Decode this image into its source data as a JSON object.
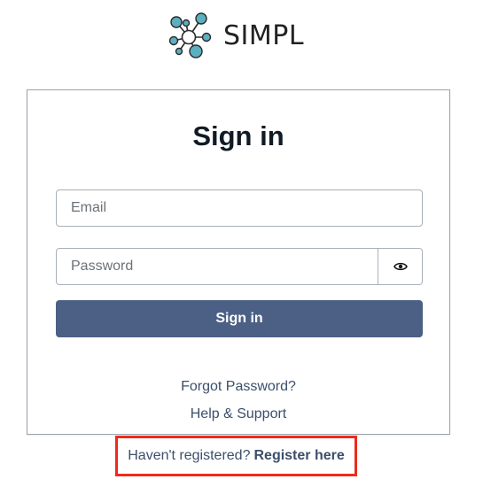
{
  "brand": {
    "name": "SIMPL",
    "logo_icon": "molecule-network-icon",
    "logo_colors": {
      "node": "#5ab0c0",
      "stroke": "#2a2a2a"
    }
  },
  "signin": {
    "title": "Sign in",
    "email_placeholder": "Email",
    "password_placeholder": "Password",
    "show_password_icon": "eye-icon",
    "submit_label": "Sign in",
    "forgot_password": "Forgot Password?",
    "help_support": "Help & Support"
  },
  "register": {
    "prompt": "Haven't registered?",
    "link_label": "Register here",
    "highlight_color": "#ee2a1b"
  },
  "colors": {
    "primary_button": "#4b6084",
    "link_text": "#3c4f6b"
  }
}
